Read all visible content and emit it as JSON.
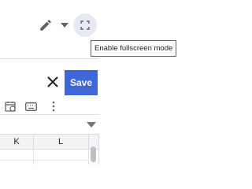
{
  "toolbar": {
    "pencil_icon": "pencil-icon",
    "dropdown_icon": "caret-down-icon",
    "fullscreen_icon": "fullscreen-icon",
    "tooltip_text": "Enable fullscreen mode"
  },
  "panel": {
    "close_icon": "close-icon",
    "save_label": "Save",
    "save_color": "#3f68d7"
  },
  "format_toolbar": {
    "icons": [
      "calendar-icon",
      "keyboard-icon",
      "more-vert-icon"
    ]
  },
  "grid": {
    "columns": [
      "K",
      "L"
    ]
  }
}
